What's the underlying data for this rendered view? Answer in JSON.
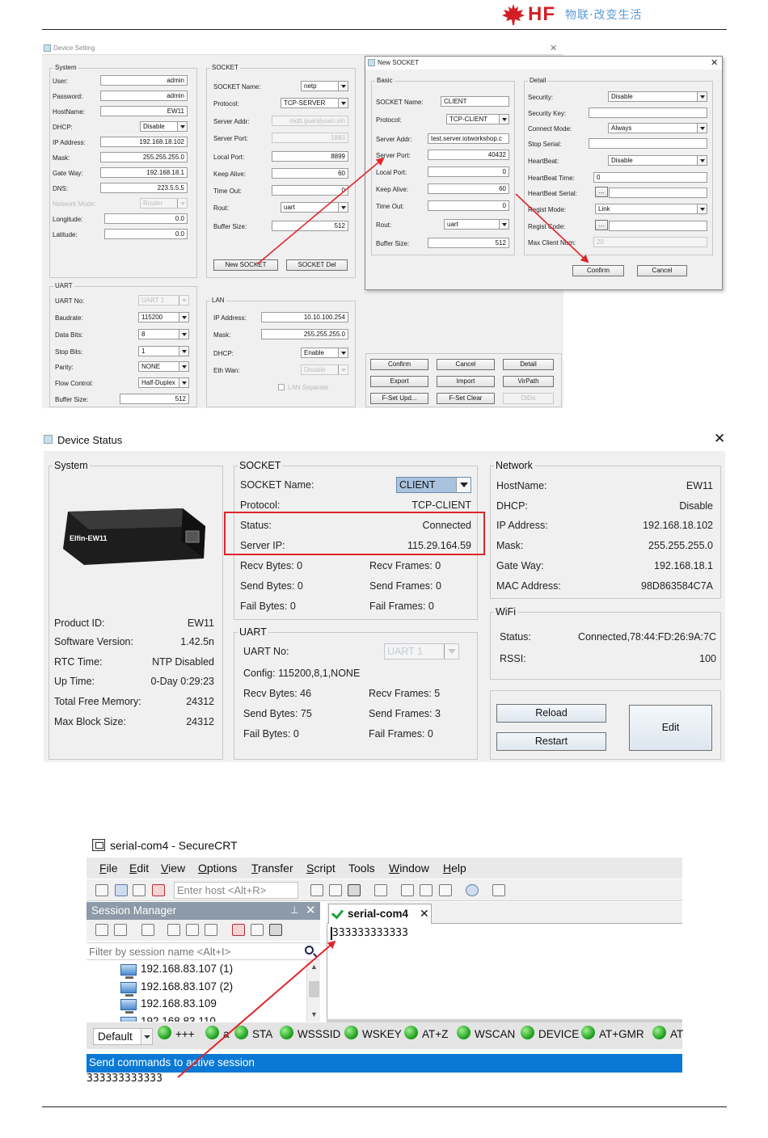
{
  "header": {
    "brand": "HF",
    "tagline": "物联·改变生活",
    "colors": {
      "brand": "#d21f26",
      "tagline": "#5b9ad6",
      "highlight": "#e0242b"
    }
  },
  "device_setting": {
    "title": "Device Setting",
    "system": {
      "label": "System",
      "user_label": "User:",
      "user": "admin",
      "password_label": "Password:",
      "password": "admin",
      "hostname_label": "HostName:",
      "hostname": "EW11",
      "dhcp_label": "DHCP:",
      "dhcp": "Disable",
      "ip_label": "IP Address:",
      "ip": "192.168.18.102",
      "mask_label": "Mask:",
      "mask": "255.255.255.0",
      "gateway_label": "Gate Way:",
      "gateway": "192.168.18.1",
      "dns_label": "DNS:",
      "dns": "223.5.5.5",
      "netmode_label": "Network Mode:",
      "netmode": "Router",
      "longitude_label": "Longitude:",
      "longitude": "0.0",
      "latitude_label": "Latitude:",
      "latitude": "0.0"
    },
    "socket": {
      "label": "SOCKET",
      "name_label": "SOCKET Name:",
      "name": "netp",
      "protocol_label": "Protocol:",
      "protocol": "TCP-SERVER",
      "server_addr_label": "Server Addr:",
      "server_addr": "mqtt.guanjiyuan.sin",
      "server_port_label": "Server Port:",
      "server_port": "1883",
      "local_port_label": "Local Port:",
      "local_port": "8899",
      "keep_alive_label": "Keep Alive:",
      "keep_alive": "60",
      "timeout_label": "Time Out:",
      "timeout": "0",
      "rout_label": "Rout:",
      "rout": "uart",
      "buffer_label": "Buffer Size:",
      "buffer": "512",
      "new_button": "New SOCKET",
      "del_button": "SOCKET Del"
    },
    "uart": {
      "label": "UART",
      "no_label": "UART No:",
      "no": "UART 1",
      "baud_label": "Baudrate:",
      "baud": "115200",
      "data_label": "Data Bits:",
      "data": "8",
      "stop_label": "Stop Bits:",
      "stop": "1",
      "parity_label": "Parity:",
      "parity": "NONE",
      "flow_label": "Flow Control:",
      "flow": "Half-Duplex",
      "buffer_label": "Buffer Size:",
      "buffer": "512"
    },
    "lan": {
      "label": "LAN",
      "ip_label": "IP Address:",
      "ip": "10.10.100.254",
      "mask_label": "Mask:",
      "mask": "255.255.255.0",
      "dhcp_label": "DHCP:",
      "dhcp": "Enable",
      "ethwan_label": "Eth Wan:",
      "ethwan": "Disable",
      "separate_label": "LAN Separate"
    },
    "buttons": {
      "confirm": "Confirm",
      "cancel": "Cancel",
      "detail": "Detail",
      "export": "Export",
      "import": "Import",
      "virpath": "VirPath",
      "fset_upd": "F-Set Upd...",
      "fset_clear": "F-Set Clear",
      "dido": "DiDo"
    }
  },
  "new_socket": {
    "title": "New SOCKET",
    "basic": {
      "label": "Basic",
      "name_label": "SOCKET Name:",
      "name": "CLIENT",
      "protocol_label": "Protocol:",
      "protocol": "TCP-CLIENT",
      "server_addr_label": "Server Addr:",
      "server_addr": "test.server.iotworkshop.c",
      "server_port_label": "Server Port:",
      "server_port": "40432",
      "local_port_label": "Local Port:",
      "local_port": "0",
      "keep_alive_label": "Keep Alive:",
      "keep_alive": "60",
      "timeout_label": "Time Out:",
      "timeout": "0",
      "rout_label": "Rout:",
      "rout": "uart",
      "buffer_label": "Buffer Size:",
      "buffer": "512"
    },
    "detail": {
      "label": "Detail",
      "security_label": "Security:",
      "security": "Disable",
      "security_key_label": "Security Key:",
      "security_key": "",
      "connect_mode_label": "Connect Mode:",
      "connect_mode": "Always",
      "stop_serial_label": "Stop Serial:",
      "stop_serial": "",
      "heartbeat_label": "HeartBeat:",
      "heartbeat": "Disable",
      "heartbeat_time_label": "HeartBeat Time:",
      "heartbeat_time": "0",
      "heartbeat_serial_label": "HeartBeat Serial:",
      "regist_mode_label": "Regist Mode:",
      "regist_mode": "Link",
      "regist_code_label": "Regist Code:",
      "max_client_label": "Max Client Num:",
      "max_client": "20",
      "ellipsis": "..."
    },
    "confirm": "Confirm",
    "cancel": "Cancel"
  },
  "device_status": {
    "title": "Device Status",
    "system": {
      "label": "System",
      "product_image_text": "Elfin-EW11",
      "product_id_label": "Product ID:",
      "product_id": "EW11",
      "sw_label": "Software Version:",
      "sw": "1.42.5n",
      "rtc_label": "RTC Time:",
      "rtc": "NTP Disabled",
      "uptime_label": "Up Time:",
      "uptime": "0-Day 0:29:23",
      "free_mem_label": "Total Free Memory:",
      "free_mem": "24312",
      "max_block_label": "Max Block Size:",
      "max_block": "24312"
    },
    "socket": {
      "label": "SOCKET",
      "name_label": "SOCKET Name:",
      "name": "CLIENT",
      "protocol_label": "Protocol:",
      "protocol": "TCP-CLIENT",
      "status_label": "Status:",
      "status": "Connected",
      "server_ip_label": "Server IP:",
      "server_ip": "115.29.164.59",
      "recv_bytes": "Recv Bytes: 0",
      "recv_frames": "Recv Frames: 0",
      "send_bytes": "Send Bytes: 0",
      "send_frames": "Send Frames: 0",
      "fail_bytes": "Fail Bytes: 0",
      "fail_frames": "Fail Frames: 0"
    },
    "uart": {
      "label": "UART",
      "no_label": "UART No:",
      "no": "UART 1",
      "config": "Config: 115200,8,1,NONE",
      "recv_bytes": "Recv Bytes: 46",
      "recv_frames": "Recv Frames: 5",
      "send_bytes": "Send Bytes: 75",
      "send_frames": "Send Frames: 3",
      "fail_bytes": "Fail Bytes: 0",
      "fail_frames": "Fail Frames: 0"
    },
    "network": {
      "label": "Network",
      "hostname_label": "HostName:",
      "hostname": "EW11",
      "dhcp_label": "DHCP:",
      "dhcp": "Disable",
      "ip_label": "IP Address:",
      "ip": "192.168.18.102",
      "mask_label": "Mask:",
      "mask": "255.255.255.0",
      "gateway_label": "Gate Way:",
      "gateway": "192.168.18.1",
      "mac_label": "MAC Address:",
      "mac": "98D863584C7A"
    },
    "wifi": {
      "label": "WiFi",
      "status_label": "Status:",
      "status": "Connected,78:44:FD:26:9A:7C",
      "rssi_label": "RSSI:",
      "rssi": "100"
    },
    "reload": "Reload",
    "restart": "Restart",
    "edit": "Edit"
  },
  "securecrt": {
    "title": "serial-com4 - SecureCRT",
    "menu": [
      {
        "key": "F",
        "rest": "ile"
      },
      {
        "key": "E",
        "rest": "dit"
      },
      {
        "key": "V",
        "rest": "iew"
      },
      {
        "key": "O",
        "rest": "ptions"
      },
      {
        "key": "T",
        "rest": "ransfer"
      },
      {
        "key": "S",
        "rest": "cript"
      },
      {
        "key": "Tools",
        "rest": ""
      },
      {
        "key": "W",
        "rest": "indow"
      },
      {
        "key": "H",
        "rest": "elp"
      }
    ],
    "host_placeholder": "Enter host <Alt+R>",
    "session_manager": "Session Manager",
    "filter_placeholder": "Filter by session name <Alt+I>",
    "sessions": [
      "192.168.83.107 (1)",
      "192.168.83.107 (2)",
      "192.168.83.109",
      "192.168.83.110"
    ],
    "tab": "serial-com4",
    "terminal_text": "333333333333",
    "button_bar_default": "Default",
    "buttons": [
      "+++",
      "a",
      "STA",
      "WSSSID",
      "WSKEY",
      "AT+Z",
      "WSCAN",
      "DEVICE",
      "AT+GMR",
      "AT"
    ],
    "send_label": "Send commands to active session",
    "input_text": "333333333333"
  }
}
